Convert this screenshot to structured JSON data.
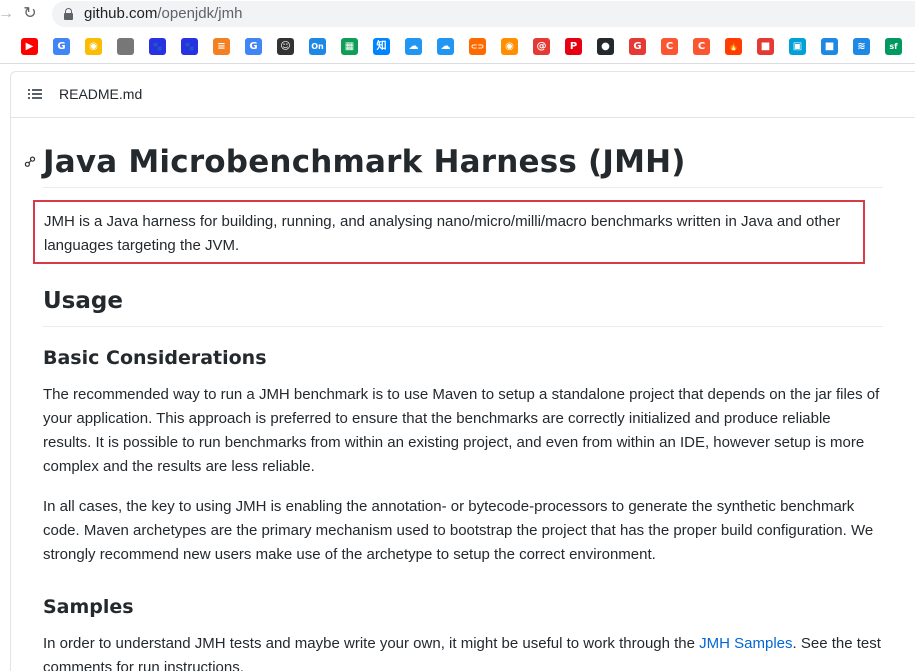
{
  "browser": {
    "url_host": "github.com",
    "url_path": "/openjdk/jmh",
    "bookmarks": [
      {
        "icon": "youtube-icon",
        "glyph": "▶",
        "color": "#ff0000"
      },
      {
        "icon": "translate-icon",
        "glyph": "G",
        "color": "#4285f4"
      },
      {
        "icon": "chrome-icon",
        "glyph": "◉",
        "color": "#fbbc05"
      },
      {
        "icon": "apple-icon",
        "glyph": "",
        "color": "#777777"
      },
      {
        "icon": "baidu-icon",
        "glyph": "🐾",
        "color": "#2932e1"
      },
      {
        "icon": "baidu-icon-2",
        "glyph": "🐾",
        "color": "#2932e1"
      },
      {
        "icon": "stackoverflow-icon",
        "glyph": "≡",
        "color": "#f48024"
      },
      {
        "icon": "google-icon",
        "glyph": "G",
        "color": "#4285f4"
      },
      {
        "icon": "smiley-icon",
        "glyph": "☺",
        "color": "#333333"
      },
      {
        "icon": "onenote-icon",
        "glyph": "On",
        "color": "#1e88e5"
      },
      {
        "icon": "sheets-icon",
        "glyph": "▦",
        "color": "#0f9d58"
      },
      {
        "icon": "zhihu-icon",
        "glyph": "知",
        "color": "#0084ff"
      },
      {
        "icon": "cloud-icon",
        "glyph": "☁",
        "color": "#2196f3"
      },
      {
        "icon": "cloud-icon-2",
        "glyph": "☁",
        "color": "#2196f3"
      },
      {
        "icon": "link-bracket-icon",
        "glyph": "⊂⊃",
        "color": "#ff6a00"
      },
      {
        "icon": "orange-circle-icon",
        "glyph": "◉",
        "color": "#ff8f00"
      },
      {
        "icon": "at-icon",
        "glyph": "@",
        "color": "#e53935"
      },
      {
        "icon": "p-icon",
        "glyph": "P",
        "color": "#e60012"
      },
      {
        "icon": "github-icon",
        "glyph": "●",
        "color": "#24292e"
      },
      {
        "icon": "red-g-icon",
        "glyph": "G",
        "color": "#e53935"
      },
      {
        "icon": "csdn-icon",
        "glyph": "C",
        "color": "#fc5531"
      },
      {
        "icon": "csdn-icon-2",
        "glyph": "C",
        "color": "#fc5531"
      },
      {
        "icon": "flame-icon",
        "glyph": "🔥",
        "color": "#ff3d00"
      },
      {
        "icon": "red-chat-icon",
        "glyph": "■",
        "color": "#e53935"
      },
      {
        "icon": "bilibili-icon",
        "glyph": "▣",
        "color": "#00a1d6"
      },
      {
        "icon": "blue-box-icon",
        "glyph": "■",
        "color": "#1e88e5"
      },
      {
        "icon": "layers-icon",
        "glyph": "≋",
        "color": "#1e88e5"
      },
      {
        "icon": "segmentfault-icon",
        "glyph": "sf",
        "color": "#009a61"
      }
    ]
  },
  "readme": {
    "filename": "README.md",
    "title": "Java Microbenchmark Harness (JMH)",
    "intro": "JMH is a Java harness for building, running, and analysing nano/micro/milli/macro benchmarks written in Java and other languages targeting the JVM.",
    "usage_heading": "Usage",
    "basic_heading": "Basic Considerations",
    "basic_p1": "The recommended way to run a JMH benchmark is to use Maven to setup a standalone project that depends on the jar files of your application. This approach is preferred to ensure that the benchmarks are correctly initialized and produce reliable results. It is possible to run benchmarks from within an existing project, and even from within an IDE, however setup is more complex and the results are less reliable.",
    "basic_p2": "In all cases, the key to using JMH is enabling the annotation- or bytecode-processors to generate the synthetic benchmark code. Maven archetypes are the primary mechanism used to bootstrap the project that has the proper build configuration. We strongly recommend new users make use of the archetype to setup the correct environment.",
    "samples_heading": "Samples",
    "samples_p_before": "In order to understand JMH tests and maybe write your own, it might be useful to work through the ",
    "samples_link": "JMH Samples",
    "samples_p_after": ". See the test comments for run instructions."
  }
}
